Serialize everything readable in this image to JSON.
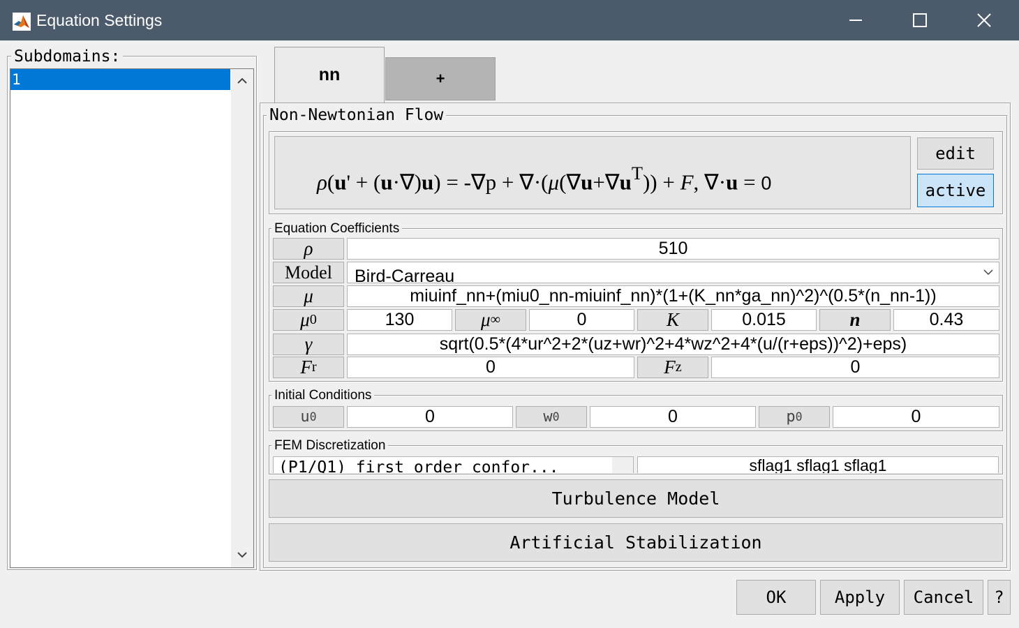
{
  "window": {
    "title": "Equation Settings"
  },
  "subdomains": {
    "legend": "Subdomains:",
    "items": [
      "1"
    ]
  },
  "tabs": [
    {
      "label": "nn"
    },
    {
      "label": "+"
    }
  ],
  "panel": {
    "legend": "Non-Newtonian Flow"
  },
  "equation": {
    "edit_label": "edit",
    "active_label": "active"
  },
  "coefficients": {
    "legend": "Equation Coefficients",
    "rho": {
      "label": "ρ",
      "value": "510"
    },
    "model": {
      "label": "Model",
      "value": "Bird-Carreau"
    },
    "mu": {
      "label": "μ",
      "value": "miuinf_nn+(miu0_nn-miuinf_nn)*(1+(K_nn*ga_nn)^2)^(0.5*(n_nn-1))"
    },
    "mu0": {
      "label": "μ",
      "sub": "0",
      "value": "130"
    },
    "muinf": {
      "label": "μ",
      "sub": "∞",
      "value": "0"
    },
    "K": {
      "label": "K",
      "value": "0.015"
    },
    "n": {
      "label": "n",
      "value": "0.43"
    },
    "gamma": {
      "label": "γ",
      "value": "sqrt(0.5*(4*ur^2+2*(uz+wr)^2+4*wz^2+4*(u/(r+eps))^2)+eps)"
    },
    "Fr": {
      "label": "F",
      "sub": "r",
      "value": "0"
    },
    "Fz": {
      "label": "F",
      "sub": "z",
      "value": "0"
    }
  },
  "initial": {
    "legend": "Initial Conditions",
    "u0": {
      "label": "u",
      "sub": "0",
      "value": "0"
    },
    "w0": {
      "label": "w",
      "sub": "0",
      "value": "0"
    },
    "p0": {
      "label": "p",
      "sub": "0",
      "value": "0"
    }
  },
  "fem": {
    "legend": "FEM Discretization",
    "element": "(P1/Q1) first order confor...",
    "flags": "sflag1 sflag1 sflag1"
  },
  "buttons": {
    "turbulence": "Turbulence Model",
    "stabilization": "Artificial Stabilization",
    "ok": "OK",
    "apply": "Apply",
    "cancel": "Cancel",
    "help": "?"
  },
  "colors": {
    "titlebar": "#4c5b6b",
    "selection": "#0078d7",
    "active_button": "#cce4f7",
    "tab_inactive": "#b4b4b4"
  }
}
